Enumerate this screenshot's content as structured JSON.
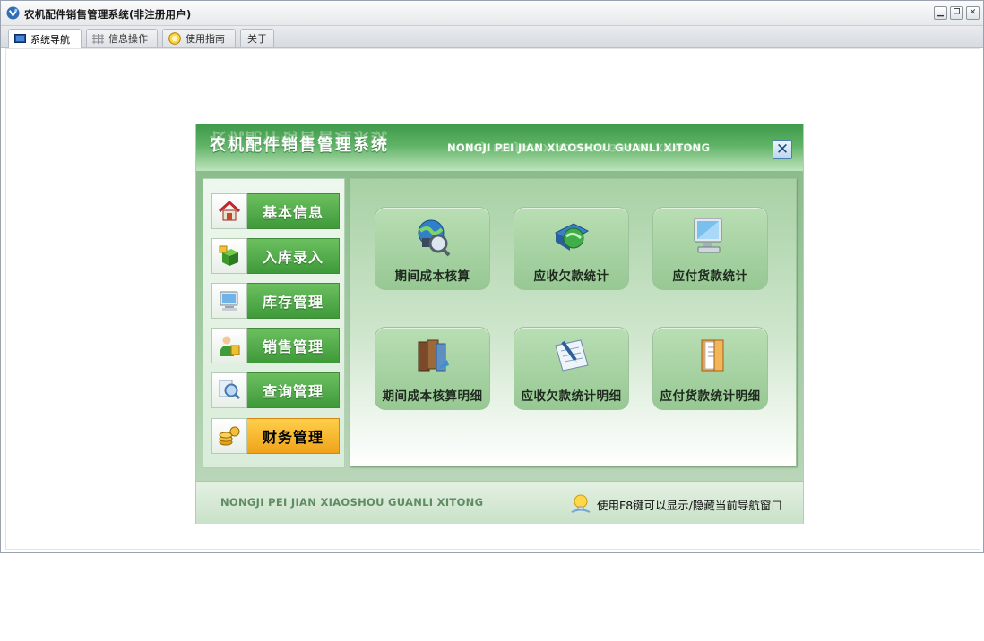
{
  "window": {
    "title": "农机配件销售管理系统(非注册用户)",
    "controls": [
      "minimize-icon",
      "restore-icon",
      "close-icon"
    ]
  },
  "tabs": [
    {
      "label": "系统导航",
      "icon": "monitor-icon",
      "active": true
    },
    {
      "label": "信息操作",
      "icon": "grid-icon",
      "active": false
    },
    {
      "label": "使用指南",
      "icon": "guide-icon",
      "active": false
    },
    {
      "label": "关于",
      "icon": "",
      "active": false
    }
  ],
  "nav": {
    "title": "农机配件销售管理系统",
    "pinyin": "NONGJI PEI JIAN XIAOSHOU GUANLI XITONG",
    "close_glyph": "✕",
    "menu": [
      {
        "label": "基本信息",
        "icon": "house-icon",
        "active": false
      },
      {
        "label": "入库录入",
        "icon": "box-icon",
        "active": false
      },
      {
        "label": "库存管理",
        "icon": "computer-icon",
        "active": false
      },
      {
        "label": "销售管理",
        "icon": "salesperson-icon",
        "active": false
      },
      {
        "label": "查询管理",
        "icon": "magnifier-icon",
        "active": false
      },
      {
        "label": "财务管理",
        "icon": "coins-icon",
        "active": true
      }
    ],
    "functions": [
      {
        "label": "期间成本核算",
        "icon": "globe-search-icon"
      },
      {
        "label": "应收欠款统计",
        "icon": "globe-book-icon"
      },
      {
        "label": "应付货款统计",
        "icon": "monitor-icon"
      },
      {
        "label": "期间成本核算明细",
        "icon": "books-icon"
      },
      {
        "label": "应收欠款统计明细",
        "icon": "document-pen-icon"
      },
      {
        "label": "应付货款统计明细",
        "icon": "folder-icon"
      }
    ],
    "footer": {
      "pinyin": "NONGJI PEI JIAN XIAOSHOU GUANLI XITONG",
      "tip": "使用F8键可以显示/隐藏当前导航窗口",
      "tip_icon": "lightbulb-icon"
    }
  },
  "colors": {
    "header_green": "#3f9a4a",
    "menu_green": "#4fa845",
    "menu_active": "#f0a21a",
    "panel_bg": "#cfe3cf"
  }
}
